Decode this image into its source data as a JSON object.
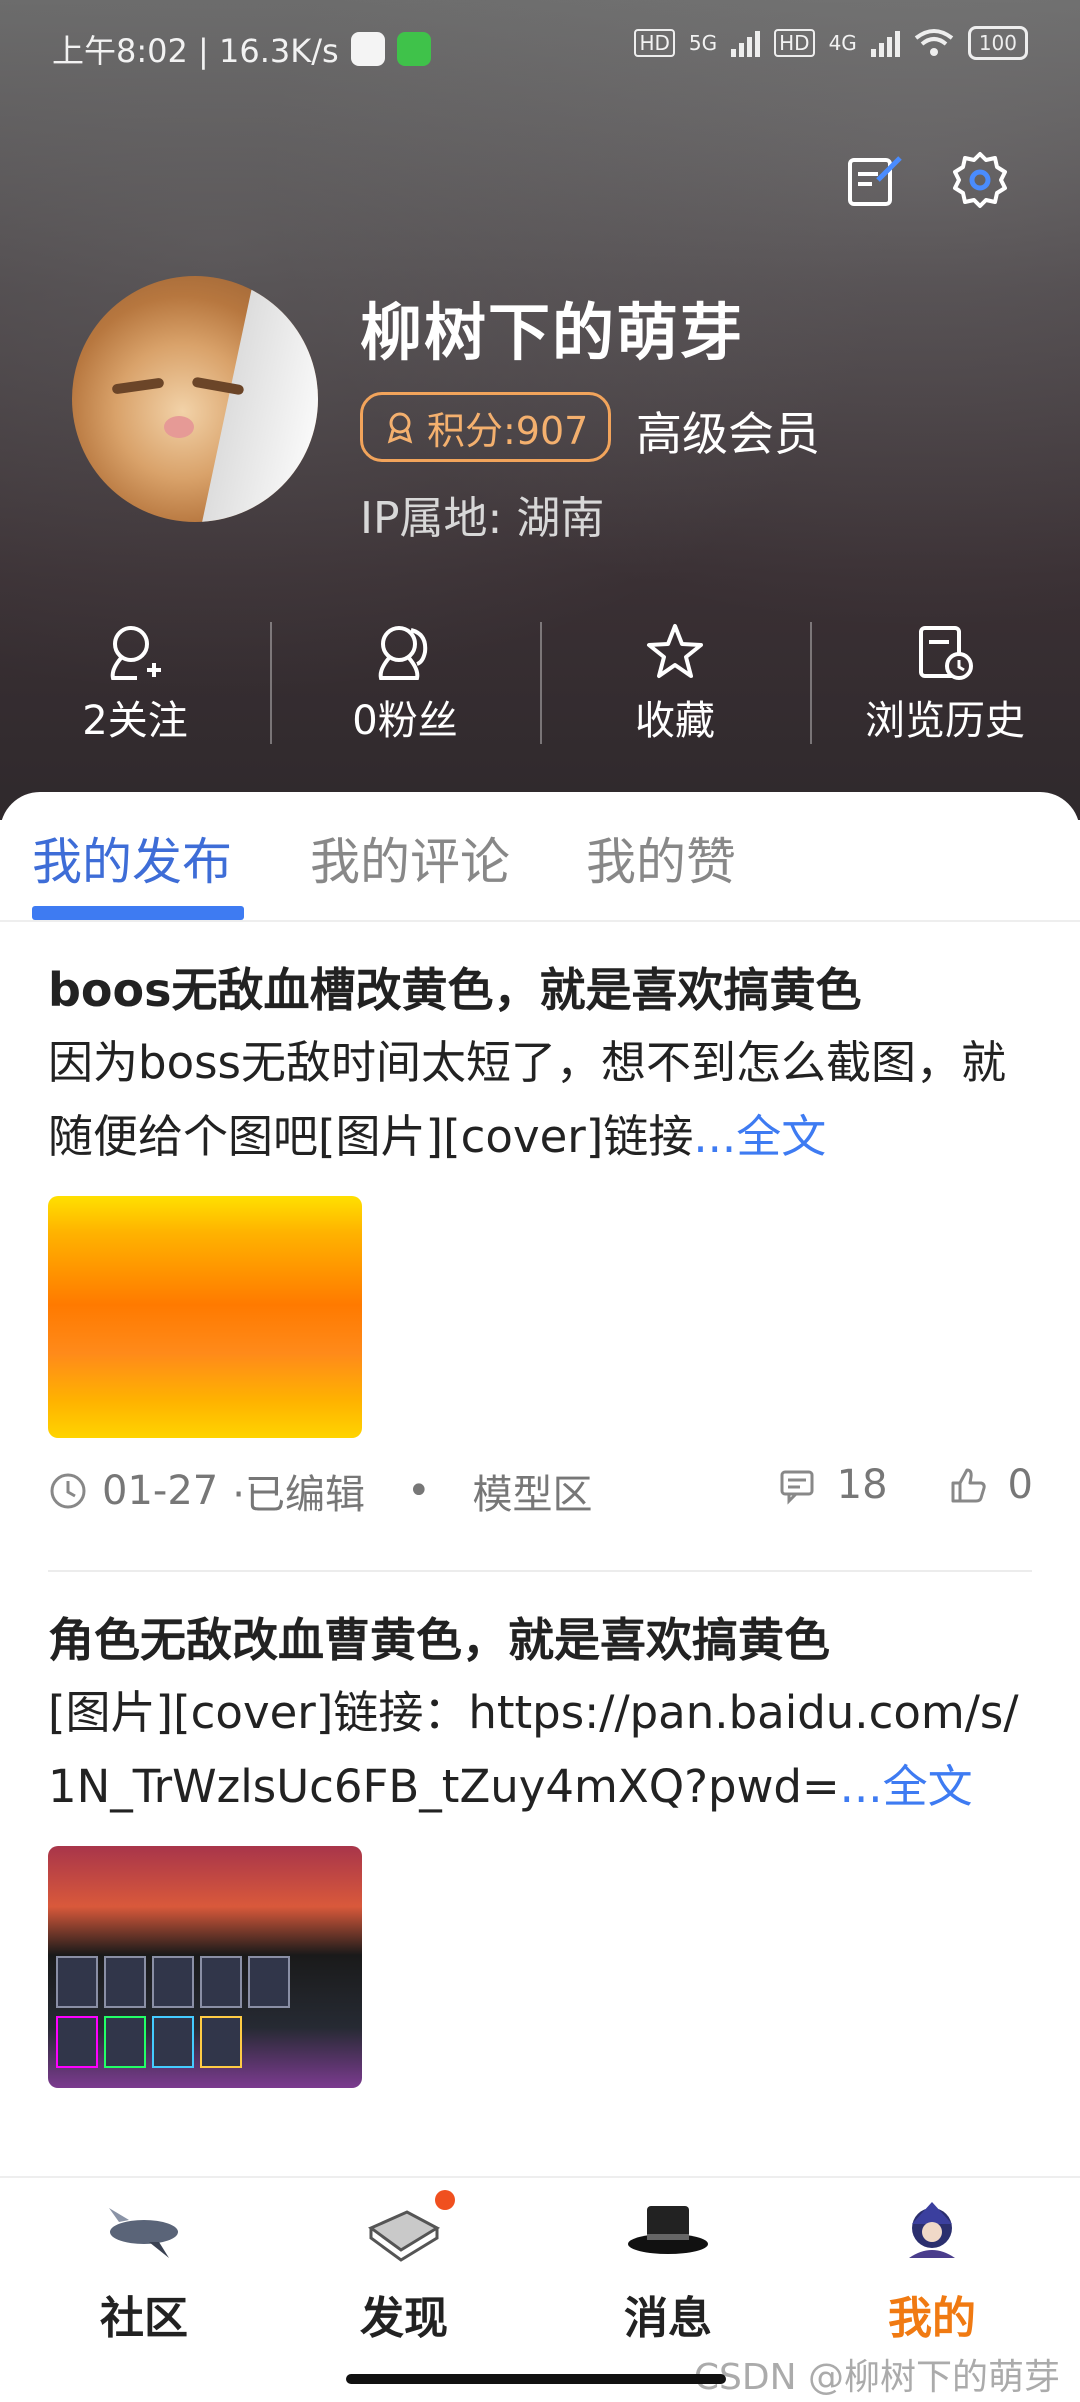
{
  "status_bar": {
    "time_speed": "上午8:02 | 16.3K/s",
    "network1": "5G",
    "network2": "4G",
    "battery": "100"
  },
  "profile": {
    "username": "柳树下的萌芽",
    "score_label": "积分:907",
    "member_level": "高级会员",
    "ip_location": "IP属地: 湖南"
  },
  "stats": [
    {
      "label": "2关注",
      "icon": "user-add-icon"
    },
    {
      "label": "0粉丝",
      "icon": "users-icon"
    },
    {
      "label": "收藏",
      "icon": "star-icon"
    },
    {
      "label": "浏览历史",
      "icon": "history-icon"
    }
  ],
  "tabs": [
    {
      "label": "我的发布",
      "active": true
    },
    {
      "label": "我的评论",
      "active": false
    },
    {
      "label": "我的赞",
      "active": false
    }
  ],
  "posts": [
    {
      "title": "boos无敌血槽改黄色，就是喜欢搞黄色",
      "body": " 因为boss无敌时间太短了，想不到怎么截图，就随便给个图吧[图片][cover]链接",
      "more": "...全文",
      "date": "01-27",
      "edited": "·已编辑",
      "dot": "•",
      "category": "模型区",
      "comments": "18",
      "likes": "0"
    },
    {
      "title": "角色无敌改血曹黄色，就是喜欢搞黄色",
      "body": " [图片][cover]链接：https://pan.baidu.com/s/1N_TrWzlsUc6FB_tZuy4mXQ?pwd=",
      "more": "...全文"
    }
  ],
  "bottom_nav": [
    {
      "label": "社区",
      "active": false
    },
    {
      "label": "发现",
      "active": false,
      "badge": true
    },
    {
      "label": "消息",
      "active": false
    },
    {
      "label": "我的",
      "active": true
    }
  ],
  "watermark": "CSDN @柳树下的萌芽",
  "colors": {
    "accent": "#3e7bf2",
    "active_nav": "#f07a12",
    "score": "#f2a45b"
  }
}
